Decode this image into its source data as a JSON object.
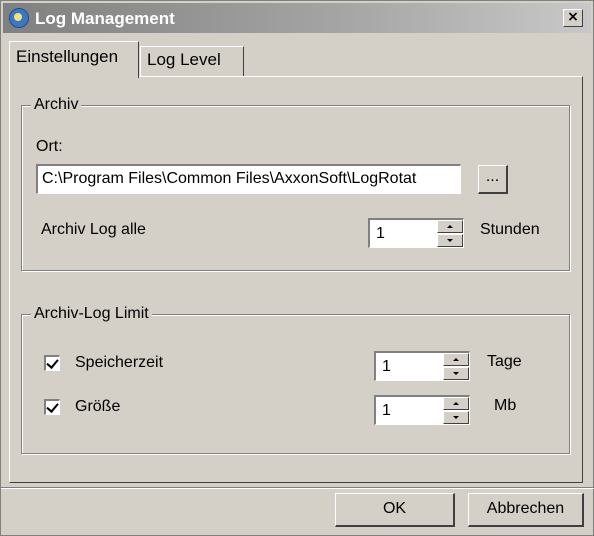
{
  "window": {
    "title": "Log Management",
    "close_symbol": "×",
    "icon": "log-management-app-icon"
  },
  "tabs": [
    {
      "label": "Einstellungen",
      "active": true
    },
    {
      "label": "Log Level",
      "active": false
    }
  ],
  "archive": {
    "legend": "Archiv",
    "location_label": "Ort:",
    "location_value": "C:\\Program Files\\Common Files\\AxxonSoft\\LogRotat",
    "browse_label": "...",
    "interval_label": "Archiv Log alle",
    "interval_value": "1",
    "interval_unit": "Stunden"
  },
  "limit": {
    "legend": "Archiv-Log Limit",
    "retention": {
      "label": "Speicherzeit",
      "checked": true,
      "value": "1",
      "unit": "Tage"
    },
    "size": {
      "label": "Größe",
      "checked": true,
      "value": "1",
      "unit": "Mb"
    }
  },
  "footer": {
    "ok_label": "OK",
    "cancel_label": "Abbrechen"
  }
}
